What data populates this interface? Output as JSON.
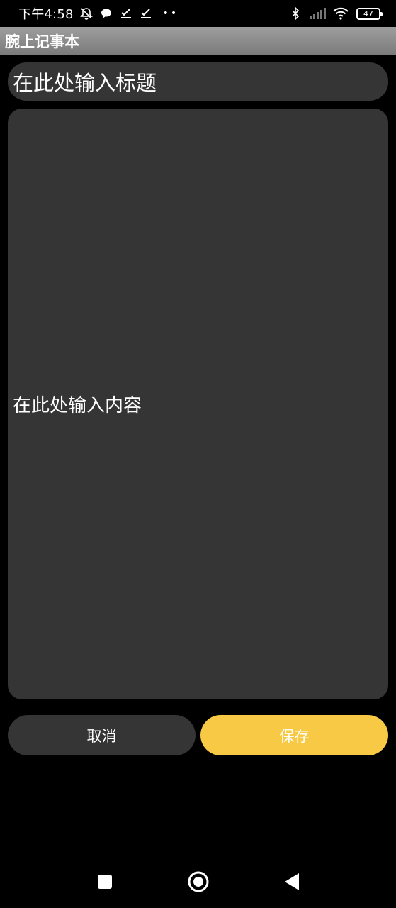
{
  "status_bar": {
    "time": "下午4:58",
    "battery_level": "47",
    "icons": [
      "alarm-off-icon",
      "message-icon",
      "check-icon",
      "check-icon",
      "more-dots-icon",
      "bluetooth-icon",
      "signal-icon",
      "wifi-icon",
      "battery-icon"
    ]
  },
  "app_bar": {
    "title": "腕上记事本"
  },
  "editor": {
    "title_placeholder": "在此处输入标题",
    "content_placeholder": "在此处输入内容"
  },
  "actions": {
    "cancel_label": "取消",
    "save_label": "保存"
  },
  "nav_bar": {
    "icons": [
      "recents-square-icon",
      "home-circle-icon",
      "back-triangle-icon"
    ]
  },
  "colors": {
    "background": "#000000",
    "field": "#353535",
    "accent": "#f8c945",
    "app_bar": "#8c8c8c"
  }
}
